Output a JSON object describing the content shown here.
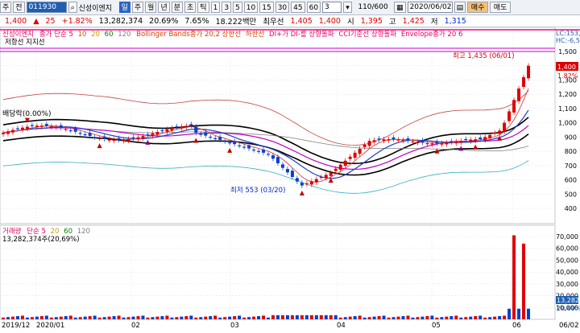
{
  "toolbar": {
    "menu_label": "주",
    "mode_label": "전",
    "code": "011930",
    "company": "신성이엔지",
    "periods": [
      "일",
      "주",
      "월",
      "년",
      "분",
      "초",
      "틱"
    ],
    "active_period": "일",
    "intervals": [
      "1",
      "3",
      "5",
      "10",
      "15",
      "30",
      "45",
      "60"
    ],
    "interval_value": "3",
    "count": "110/600",
    "date": "2020/06/02",
    "buy_label": "매수",
    "sell_label": "매도"
  },
  "quote": {
    "price": "1,400",
    "change_arrow": "▲",
    "change": "25",
    "change_pct": "+1.82%",
    "volume": "13,282,374",
    "turnover_pct": "20.69%",
    "vol_ratio": "7.65%",
    "amount": "18.222백만",
    "prev_label": "최우선",
    "ask": "1,405",
    "bid": "1,400",
    "open_label": "시",
    "open": "1,395",
    "high_label": "고",
    "high": "1,425",
    "low_label": "저",
    "low": "1,315"
  },
  "price_panel": {
    "legend": [
      "신성이엔지",
      "종가 단순 5",
      "10",
      "20",
      "60",
      "120",
      "Bollinger Bands종가 20,2 상한선",
      "하한선",
      "DI+가 DI-를 상향돌파",
      "CCI기준선 상향돌파",
      "Envelope종가 20 6"
    ],
    "sub_legend": "저항선  지지선",
    "dividend_label": "배당락(0.00%)",
    "max_label": "최고 1,435 (06/01)",
    "min_label": "최저 553 (03/20)",
    "last_price_tag": "1,400",
    "last_pct_tag": "1.82%",
    "right_corner_1": "LC:153,",
    "right_corner_2": "HC:-6,5",
    "y_ticks": [
      "1,500",
      "1,400",
      "1,300",
      "1,200",
      "1,100",
      "1,000",
      "900",
      "800",
      "700",
      "600",
      "500",
      "400"
    ]
  },
  "volume_panel": {
    "legend_title": "거래량",
    "legend_ma": [
      "단순 5",
      "20",
      "60",
      "120"
    ],
    "volume_text": "13,282,374주(20,69%)",
    "y_ticks": [
      "70,000",
      "60,000",
      "50,000",
      "40,000",
      "30,000",
      "20,000",
      "10,000"
    ],
    "last_tag": "13,282",
    "last_pct": "20.69%"
  },
  "x_axis": [
    "2019/12",
    "2020/01",
    "02",
    "03",
    "04",
    "05",
    "06",
    "06/02"
  ],
  "colors": {
    "up": "#e00000",
    "down": "#0040d0",
    "accent": "#1e5fb4"
  },
  "chart_data": {
    "type": "candlestick",
    "x": [
      "2019/12",
      "2020/01",
      "02",
      "03",
      "04",
      "05",
      "06"
    ],
    "price_range": [
      400,
      1500
    ],
    "max": {
      "value": 1435,
      "date": "06/01"
    },
    "min": {
      "value": 553,
      "date": "03/20"
    },
    "last_close": 1400,
    "volume_range": [
      0,
      70000
    ]
  }
}
